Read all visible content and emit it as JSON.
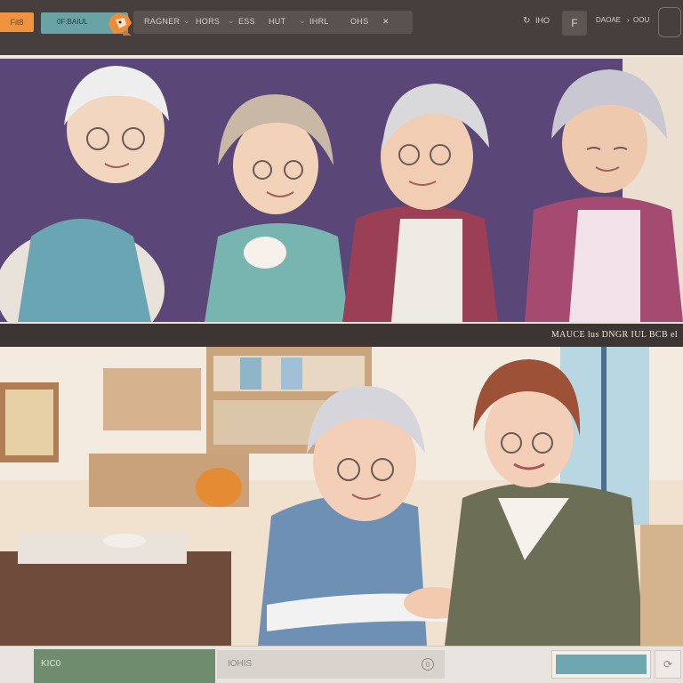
{
  "toolbar": {
    "brand_tab": "Fit8",
    "logo_text": "0F:BAIUL",
    "menu": [
      "RAGNER",
      "HORS",
      "ESS",
      "HUT",
      "IHRL",
      "OHS"
    ],
    "tools_left": "IHO",
    "font_button": "F",
    "tools_right": "DAOAE",
    "extra": "OOU"
  },
  "caption": {
    "text": "MAUCE lus DNGR IUL BCB el"
  },
  "bottom": {
    "field_label": "KIC0",
    "input_text": "IOHIS",
    "input_circle": "0"
  },
  "colors": {
    "toolbar_bg": "#463f3d",
    "accent_orange": "#ef9340",
    "accent_teal": "#6aa3a6",
    "panel1_bg": "#5a4776",
    "panel2_bg": "#efe1cc",
    "action_blue": "#6fa7b1",
    "field_green": "#6f8c6f"
  },
  "icons": {
    "close_icon": "close-icon",
    "font_icon": "font-icon",
    "chevron": "chevron-right-icon",
    "refresh": "refresh-icon",
    "expand": "expand-icon"
  }
}
